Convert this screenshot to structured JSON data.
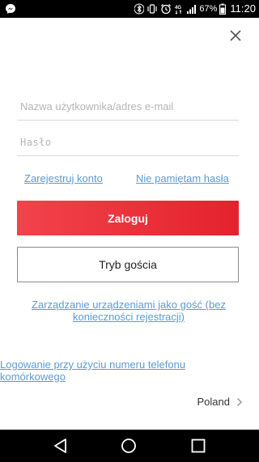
{
  "status_bar": {
    "battery_percent": "67%",
    "time": "11:20",
    "network_label": "4G"
  },
  "form": {
    "username_placeholder": "Nazwa użytkownika/adres e-mail",
    "username_value": "",
    "password_placeholder": "Hasło",
    "password_value": ""
  },
  "links": {
    "register": "Zarejestruj konto",
    "forgot_password": "Nie pamiętam hasła",
    "guest_manage": "Zarządzanie urządzeniami jako gość (bez konieczności rejestracji)",
    "phone_login": "Logowanie przy użyciu numeru telefonu komórkowego"
  },
  "buttons": {
    "login": "Zaloguj",
    "guest": "Tryb gościa"
  },
  "region": {
    "label": "Poland"
  },
  "colors": {
    "accent_red": "#e8303a",
    "link_blue": "#5b9bd5"
  },
  "icons": {
    "status_left": "messenger-icon",
    "close": "close-icon",
    "region_arrow": "chevron-right-icon"
  }
}
